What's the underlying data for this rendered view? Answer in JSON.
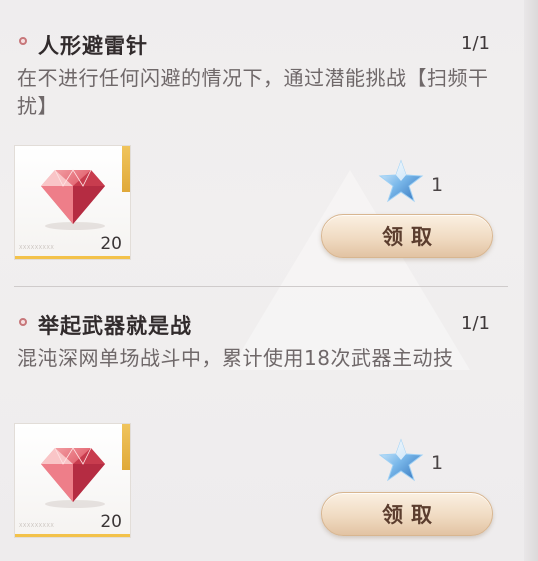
{
  "tasks": [
    {
      "title": "人形避雷针",
      "progress": "1/1",
      "description": "在不进行任何闪避的情况下，通过潜能挑战【扫频干扰】",
      "reward": {
        "item_icon": "red-diamond-icon",
        "count": "20",
        "card_mark": "XXXXXXXXX"
      },
      "star_reward": {
        "icon": "blue-star-icon",
        "count": "1"
      },
      "claim_label": "领取"
    },
    {
      "title": "举起武器就是战",
      "progress": "1/1",
      "description": "混沌深网单场战斗中，累计使用18次武器主动技",
      "reward": {
        "item_icon": "red-diamond-icon",
        "count": "20",
        "card_mark": "XXXXXXXXX"
      },
      "star_reward": {
        "icon": "blue-star-icon",
        "count": "1"
      },
      "claim_label": "领取"
    }
  ],
  "colors": {
    "accent_dot": "#c7777a",
    "card_bottom": "#f3c24a",
    "button": "#f0dbc2",
    "star": "#7ab8ea"
  }
}
